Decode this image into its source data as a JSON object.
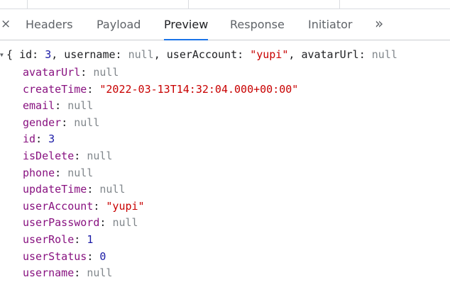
{
  "tabs": {
    "items": [
      "Headers",
      "Payload",
      "Preview",
      "Response",
      "Initiator"
    ],
    "active": "Preview",
    "close_icon": "×",
    "more_icon": "»"
  },
  "preview": {
    "summary": {
      "open": "{",
      "parts": [
        {
          "key": "id",
          "value": "3",
          "type": "number"
        },
        {
          "key": "username",
          "value": "null",
          "type": "null"
        },
        {
          "key": "userAccount",
          "value": "\"yupi\"",
          "type": "string"
        },
        {
          "key": "avatarUrl",
          "value": "null",
          "type": "null"
        }
      ]
    },
    "properties": [
      {
        "key": "avatarUrl",
        "value": "null",
        "type": "null"
      },
      {
        "key": "createTime",
        "value": "\"2022-03-13T14:32:04.000+00:00\"",
        "type": "string"
      },
      {
        "key": "email",
        "value": "null",
        "type": "null"
      },
      {
        "key": "gender",
        "value": "null",
        "type": "null"
      },
      {
        "key": "id",
        "value": "3",
        "type": "number"
      },
      {
        "key": "isDelete",
        "value": "null",
        "type": "null"
      },
      {
        "key": "phone",
        "value": "null",
        "type": "null"
      },
      {
        "key": "updateTime",
        "value": "null",
        "type": "null"
      },
      {
        "key": "userAccount",
        "value": "\"yupi\"",
        "type": "string"
      },
      {
        "key": "userPassword",
        "value": "null",
        "type": "null"
      },
      {
        "key": "userRole",
        "value": "1",
        "type": "number"
      },
      {
        "key": "userStatus",
        "value": "0",
        "type": "number"
      },
      {
        "key": "username",
        "value": "null",
        "type": "null"
      }
    ]
  },
  "colors": {
    "key": "#881280",
    "string": "#c80000",
    "number": "#1a1aa6",
    "null": "#80868b",
    "active_tab_underline": "#1a73e8"
  }
}
